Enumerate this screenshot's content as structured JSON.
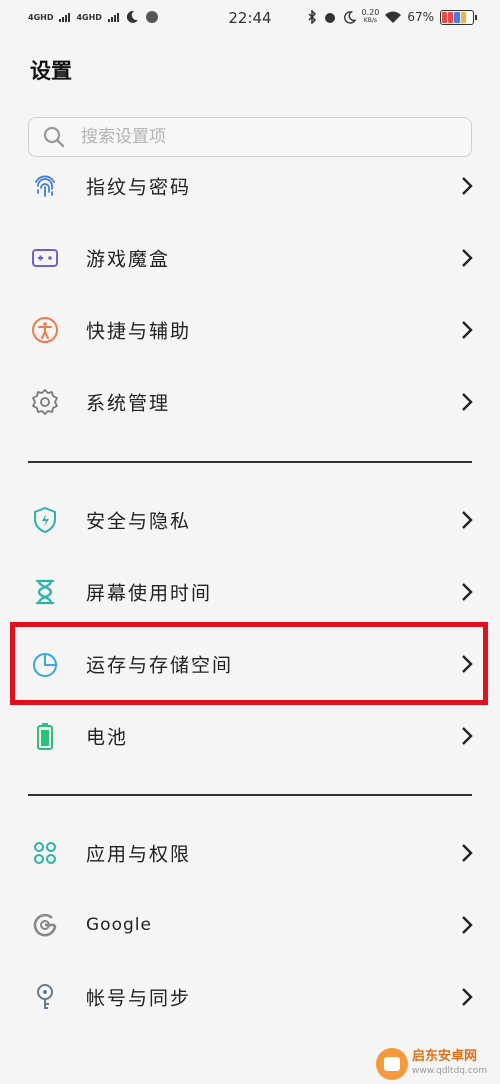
{
  "status_bar": {
    "sim1": "4GHD",
    "sim2": "4GHD",
    "time": "22:44",
    "speed": "0.20",
    "speed_unit": "KB/s",
    "battery": "67%"
  },
  "page_title": "设置",
  "search": {
    "placeholder": "搜索设置项"
  },
  "groups": [
    {
      "items": [
        {
          "label": "指纹与密码",
          "icon": "fingerprint-icon",
          "color": "#3f7ee0"
        },
        {
          "label": "游戏魔盒",
          "icon": "gamepad-icon",
          "color": "#6a62d8"
        },
        {
          "label": "快捷与辅助",
          "icon": "accessibility-icon",
          "color": "#ef7a4e"
        },
        {
          "label": "系统管理",
          "icon": "gear-icon",
          "color": "#7a7a7a"
        }
      ]
    },
    {
      "items": [
        {
          "label": "安全与隐私",
          "icon": "shield-icon",
          "color": "#2bb3a9"
        },
        {
          "label": "屏幕使用时间",
          "icon": "hourglass-icon",
          "color": "#2bb3a9"
        },
        {
          "label": "运存与存储空间",
          "icon": "pie-chart-icon",
          "color": "#35a8e0"
        },
        {
          "label": "电池",
          "icon": "battery-icon",
          "color": "#2bc07c"
        }
      ]
    },
    {
      "items": [
        {
          "label": "应用与权限",
          "icon": "apps-grid-icon",
          "color": "#2bb3a9"
        },
        {
          "label": "Google",
          "icon": "google-icon",
          "color": "#888888"
        },
        {
          "label": "帐号与同步",
          "icon": "key-icon",
          "color": "#6a7a8a"
        }
      ]
    }
  ],
  "watermark": {
    "name": "启东安卓网",
    "url": "www.qdltdq.com"
  }
}
